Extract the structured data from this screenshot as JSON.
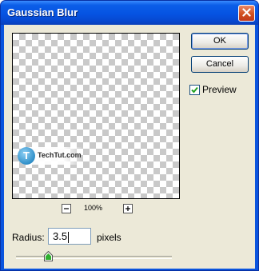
{
  "window": {
    "title": "Gaussian Blur"
  },
  "buttons": {
    "ok": "OK",
    "cancel": "Cancel"
  },
  "preview_toggle": {
    "label": "Preview",
    "checked": true
  },
  "zoom": {
    "level": "100%"
  },
  "watermark": {
    "text": "TechTut.com"
  },
  "radius": {
    "label": "Radius:",
    "value": "3.5",
    "units": "pixels",
    "slider_fraction": 0.018
  },
  "colors": {
    "titlebar": "#0553e2",
    "close": "#d1501e",
    "dialog_bg": "#ece9d8"
  }
}
